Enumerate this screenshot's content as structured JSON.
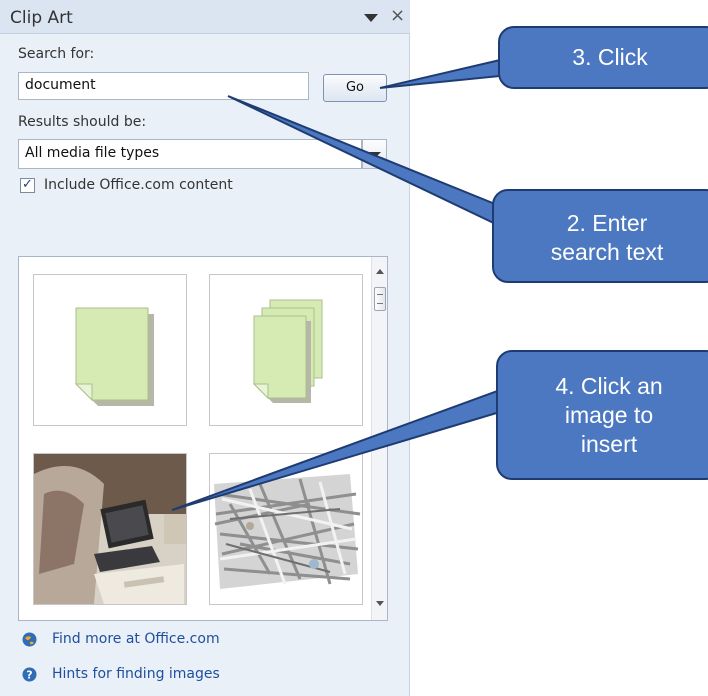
{
  "pane": {
    "title": "Clip Art",
    "search_label": "Search for:",
    "search_value": "document",
    "go_label": "Go",
    "results_label": "Results should be:",
    "media_type_value": "All media file types",
    "include_office_label": "Include Office.com content",
    "include_office_checked": true,
    "check_mark": "✓",
    "close_glyph": "×",
    "links": {
      "find_more": "Find more at Office.com",
      "hints": "Hints for finding images"
    }
  },
  "callouts": {
    "step3": "3. Click",
    "step2_line1": "2. Enter",
    "step2_line2": "search text",
    "step4_line1": "4. Click an",
    "step4_line2": "image to",
    "step4_line3": "insert"
  },
  "icons": {
    "menu": "dropdown-triangle-icon",
    "close": "close-icon",
    "find_more": "office-globe-icon",
    "hints": "help-icon"
  },
  "colors": {
    "callout_fill": "#4b78c1",
    "callout_border": "#1f3c72",
    "pane_bg": "#eaf0f8",
    "link": "#1e4e9e",
    "doc_green": "#d6eab4"
  }
}
